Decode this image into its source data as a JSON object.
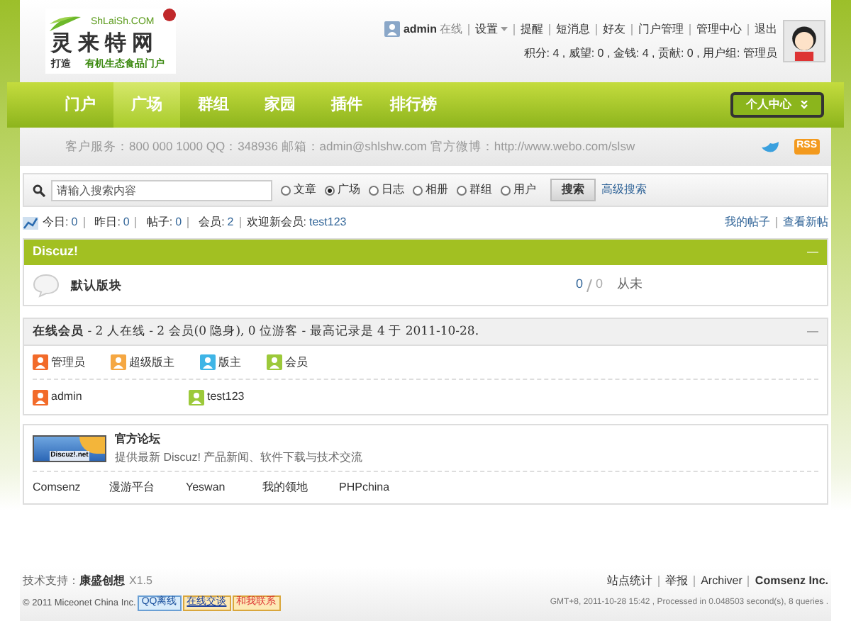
{
  "logo": {
    "domain": "ShLaiSh.COM",
    "name": "灵来特网",
    "slogan_lead": "打造",
    "slogan": "有机生态食品门户"
  },
  "user_bar": {
    "username": "admin",
    "status": "在线",
    "links": [
      {
        "label": "设置",
        "dropdown": true
      },
      {
        "label": "提醒",
        "dropdown": false
      },
      {
        "label": "短消息",
        "dropdown": false
      },
      {
        "label": "好友",
        "dropdown": false
      },
      {
        "label": "门户管理",
        "dropdown": false
      },
      {
        "label": "管理中心",
        "dropdown": false
      },
      {
        "label": "退出",
        "dropdown": false
      }
    ],
    "stats": "积分: 4 , 威望: 0 , 金钱: 4 , 贡献: 0 , 用户组: 管理员"
  },
  "nav": {
    "items": [
      {
        "label": "门户",
        "selected": false
      },
      {
        "label": "广场",
        "selected": true
      },
      {
        "label": "群组",
        "selected": false
      },
      {
        "label": "家园",
        "selected": false
      },
      {
        "label": "插件",
        "selected": false
      },
      {
        "label": "排行榜",
        "selected": false
      }
    ],
    "personal": "个人中心"
  },
  "info_bar": {
    "text": "客户服务：800 000 1000 QQ：348936 邮箱：admin@shlshw.com 官方微博：http://www.webo.com/slsw",
    "rss": "RSS"
  },
  "search": {
    "placeholder": "请输入搜索内容",
    "scopes": [
      {
        "label": "文章",
        "selected": false
      },
      {
        "label": "广场",
        "selected": true
      },
      {
        "label": "日志",
        "selected": false
      },
      {
        "label": "相册",
        "selected": false
      },
      {
        "label": "群组",
        "selected": false
      },
      {
        "label": "用户",
        "selected": false
      }
    ],
    "button": "搜索",
    "advanced": "高级搜索"
  },
  "stats": {
    "items": [
      {
        "label": "今日:",
        "value": "0"
      },
      {
        "label": "昨日:",
        "value": "0"
      },
      {
        "label": "帖子:",
        "value": "0"
      },
      {
        "label": "会员:",
        "value": "2"
      }
    ],
    "welcome": "欢迎新会员:",
    "new_member": "test123",
    "links": [
      "我的帖子",
      "查看新帖"
    ]
  },
  "category": {
    "title": "Discuz!",
    "collapse": "—",
    "forums": [
      {
        "name": "默认版块",
        "threads": "0",
        "posts": "0",
        "last": "从未"
      }
    ]
  },
  "online": {
    "title": "在线会员",
    "summary": " - 2 人在线 - 2 会员(0 隐身), 0 位游客 - 最高记录是 4 于 2011-10-28.",
    "collapse": "—",
    "legend": [
      {
        "label": "管理员",
        "color": "#f26b2a"
      },
      {
        "label": "超级版主",
        "color": "#f5a742"
      },
      {
        "label": "版主",
        "color": "#3fb5e6"
      },
      {
        "label": "会员",
        "color": "#9cc93a"
      }
    ],
    "users": [
      {
        "name": "admin",
        "color": "#f26b2a"
      },
      {
        "name": "test123",
        "color": "#9cc93a"
      }
    ]
  },
  "friend_links": {
    "featured": {
      "banner": "Discuz!.net",
      "title": "官方论坛",
      "description": "提供最新 Discuz! 产品新闻、软件下载与技术交流"
    },
    "links": [
      "Comsenz",
      "漫游平台",
      "Yeswan",
      "我的领地",
      "PHPchina"
    ]
  },
  "footer": {
    "support_label": "技术支持：",
    "support_name": "康盛创想",
    "version": "X1.5",
    "copyright": "© 2011 Miceonet China Inc.",
    "badges": [
      "QQ离线",
      "在线交谈",
      "和我联系"
    ],
    "links": [
      "站点统计",
      "举报",
      "Archiver"
    ],
    "company": "Comsenz Inc.",
    "processed": "GMT+8, 2011-10-28 15:42 , Processed in 0.048503 second(s), 8 queries ."
  }
}
